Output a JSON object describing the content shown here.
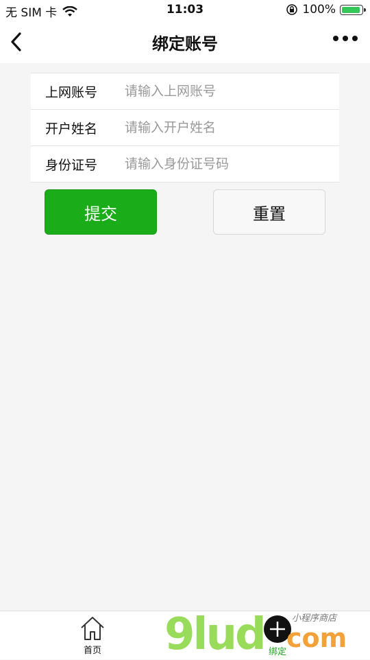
{
  "status_bar": {
    "carrier": "无 SIM 卡",
    "time": "11:03",
    "battery_text": "100%",
    "battery_level": 1.0,
    "icons": [
      "wifi-icon",
      "orientation-lock-icon",
      "battery-icon"
    ]
  },
  "nav": {
    "title": "绑定账号",
    "back_icon": "chevron-left-icon",
    "more_icon": "more-dots-icon"
  },
  "form": {
    "fields": [
      {
        "label": "上网账号",
        "placeholder": "请输入上网账号",
        "value": ""
      },
      {
        "label": "开户姓名",
        "placeholder": "请输入开户姓名",
        "value": ""
      },
      {
        "label": "身份证号",
        "placeholder": "请输入身份证号码",
        "value": ""
      }
    ]
  },
  "buttons": {
    "submit_label": "提交",
    "reset_label": "重置"
  },
  "colors": {
    "accent": "#1aad19",
    "background": "#f5f5f5"
  },
  "tab_bar": {
    "home_label": "首页",
    "home_icon": "home-icon",
    "bind_label": "绑定",
    "bind_icon": "plus-icon"
  },
  "watermark": {
    "big_text": "9lud",
    "com_text": "com",
    "small_text": "小程序商店"
  }
}
